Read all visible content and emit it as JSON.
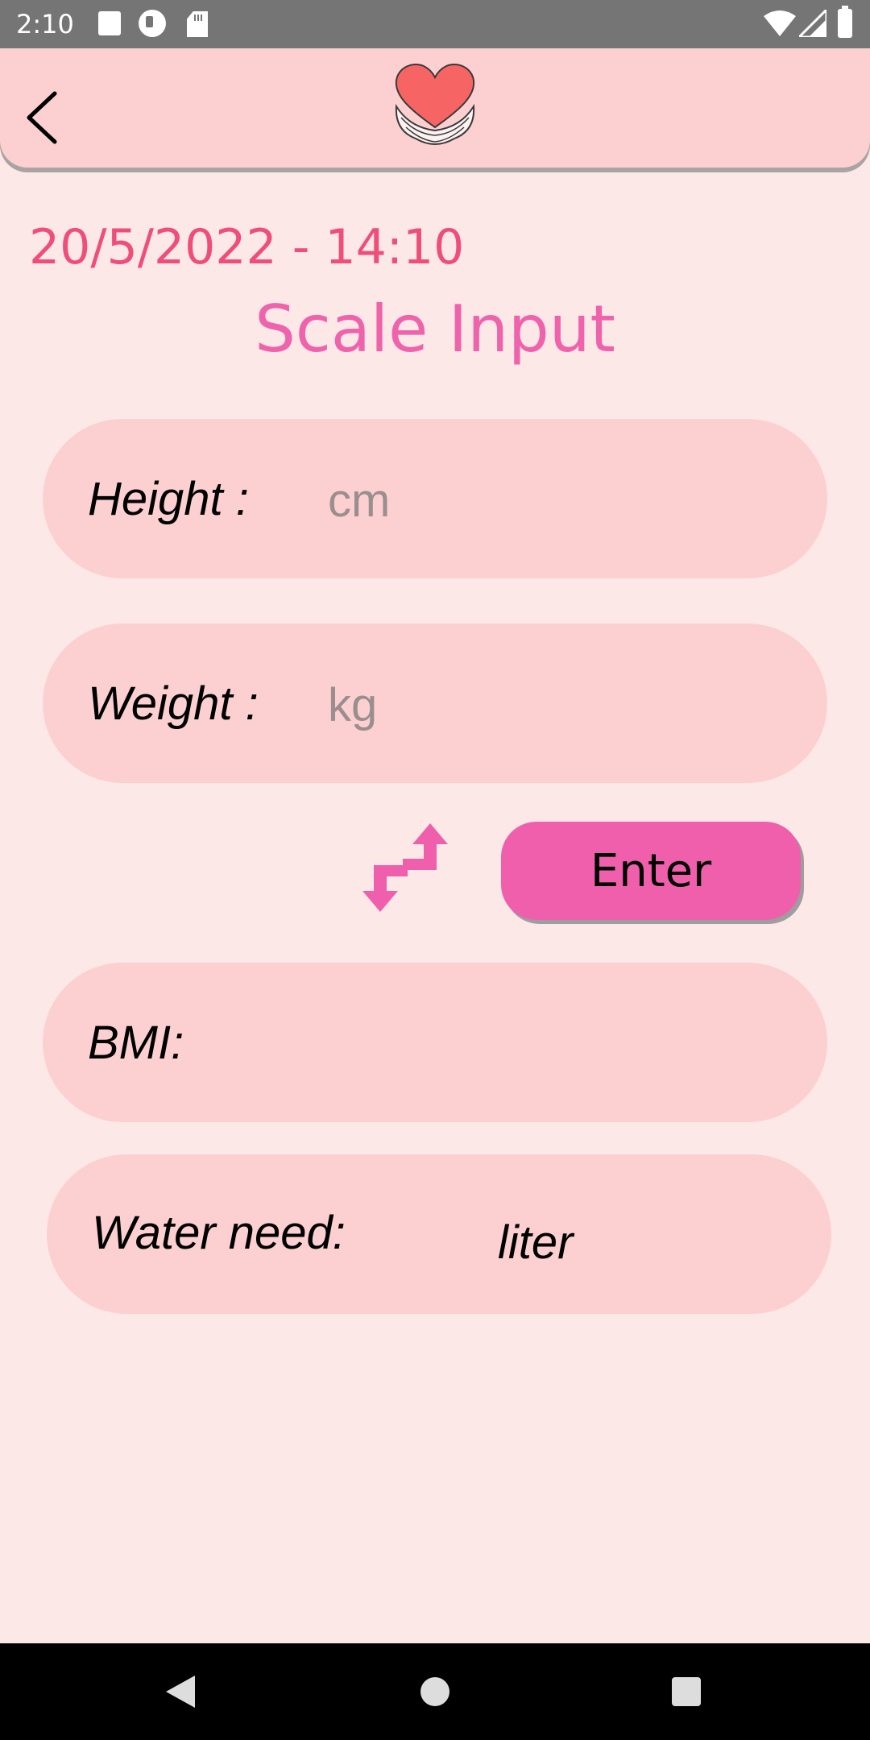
{
  "status_bar": {
    "time": "2:10",
    "icons": [
      "notification-square-icon",
      "data-saver-icon",
      "sd-card-icon",
      "wifi-icon",
      "signal-icon",
      "battery-icon"
    ]
  },
  "app_bar": {
    "back_icon": "chevron-left-icon",
    "logo_icon": "heart-hands-icon"
  },
  "datetime": "20/5/2022 - 14:10",
  "title": "Scale Input",
  "height_field": {
    "label": "Height :",
    "value": "",
    "placeholder": "cm"
  },
  "weight_field": {
    "label": "Weight :",
    "value": "",
    "placeholder": "kg"
  },
  "swap_icon": "swap-arrows-icon",
  "enter_label": "Enter",
  "bmi": {
    "label": "BMI:",
    "value": ""
  },
  "water": {
    "label": "Water need:",
    "unit": "liter"
  },
  "nav_bar": {
    "icons": [
      "nav-back-icon",
      "nav-home-icon",
      "nav-recents-icon"
    ]
  },
  "colors": {
    "background": "#fde8e8",
    "app_bar": "#fcd0d1",
    "pill": "#fcd0d1",
    "datetime": "#ee4e78",
    "title": "#ef63ad",
    "button": "#ef5fac"
  }
}
